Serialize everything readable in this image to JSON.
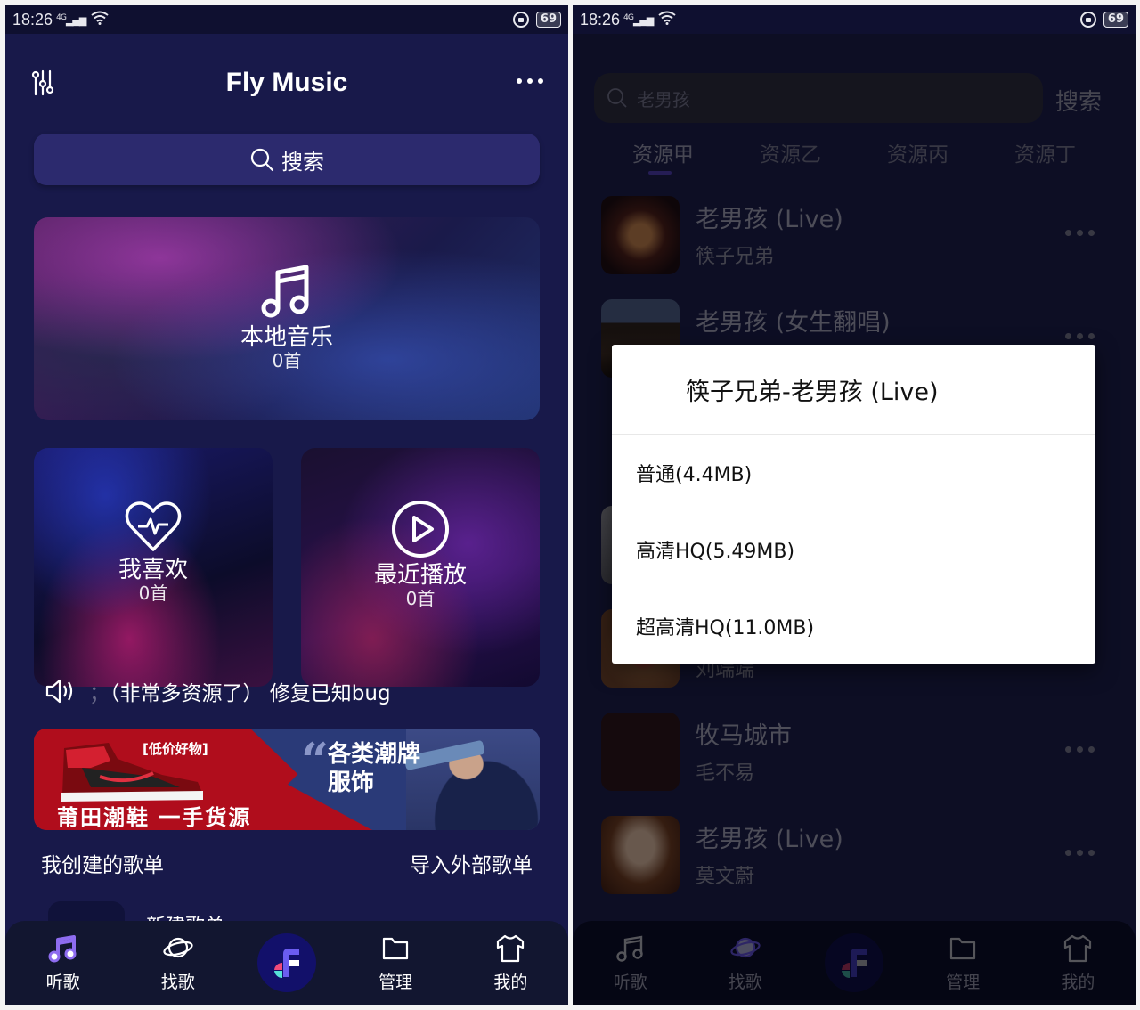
{
  "status_bar": {
    "time": "18:26",
    "network": "4G",
    "battery": "69"
  },
  "left": {
    "app_title": "Fly Music",
    "search_label": "搜索",
    "cards": {
      "local": {
        "label": "本地音乐",
        "count": "0首"
      },
      "favorites": {
        "label": "我喜欢",
        "count": "0首"
      },
      "recent": {
        "label": "最近播放",
        "count": "0首"
      }
    },
    "notice": {
      "leading": "；",
      "text": "（非常多资源了） 修复已知bug"
    },
    "ad": {
      "tag": "[低价好物]",
      "main": "莆田潮鞋  一手货源",
      "right_line1": "各类潮牌",
      "right_line2": "服饰",
      "colors": {
        "red": "#b00d1c",
        "blue": "#2a3a78"
      }
    },
    "playlists": {
      "created_label": "我创建的歌单",
      "import_label": "导入外部歌单",
      "partial_item": "新建歌单"
    }
  },
  "tabbar": {
    "items": [
      {
        "label": "听歌",
        "icon": "music-note-icon",
        "active": true
      },
      {
        "label": "找歌",
        "icon": "planet-icon",
        "active": false
      },
      {
        "label": "",
        "icon": "fly-music-logo",
        "active": false
      },
      {
        "label": "管理",
        "icon": "folder-icon",
        "active": false
      },
      {
        "label": "我的",
        "icon": "tshirt-icon",
        "active": false
      }
    ],
    "accent": "#8e6cf0"
  },
  "right": {
    "search_value": "老男孩",
    "search_button": "搜索",
    "source_tabs": [
      "资源甲",
      "资源乙",
      "资源丙",
      "资源丁"
    ],
    "active_source": 0,
    "songs": [
      {
        "title": "老男孩 (Live)",
        "artist": "筷子兄弟"
      },
      {
        "title": "老男孩 (女生翻唱)",
        "artist": ""
      },
      {
        "title": "",
        "artist": ""
      },
      {
        "title": "",
        "artist": "刘端端"
      },
      {
        "title": "牧马城市",
        "artist": "毛不易"
      },
      {
        "title": "老男孩 (Live)",
        "artist": "莫文蔚"
      }
    ],
    "dialog": {
      "title": "筷子兄弟-老男孩 (Live)",
      "options": [
        "普通(4.4MB)",
        "高清HQ(5.49MB)",
        "超高清HQ(11.0MB)"
      ]
    }
  }
}
